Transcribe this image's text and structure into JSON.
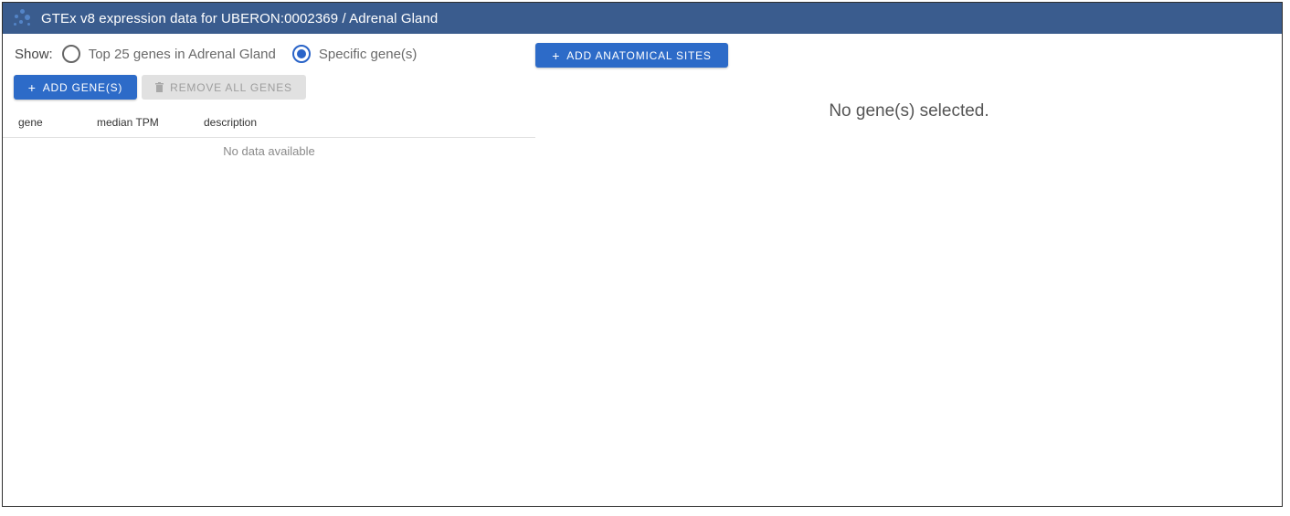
{
  "header": {
    "title": "GTEx v8 expression data for UBERON:0002369 / Adrenal Gland",
    "logo_icon": "gtex-logo-icon",
    "color": "#3a5c8e"
  },
  "controls": {
    "show_label": "Show:",
    "options": [
      {
        "label": "Top 25 genes in Adrenal Gland",
        "selected": false
      },
      {
        "label": "Specific gene(s)",
        "selected": true
      }
    ],
    "add_genes_label": "ADD GENE(S)",
    "add_genes_icon": "plus-icon",
    "remove_all_label": "REMOVE ALL GENES",
    "remove_all_icon": "trash-icon",
    "add_sites_label": "ADD ANATOMICAL SITES",
    "add_sites_icon": "plus-icon",
    "accent": "#2d6bc8"
  },
  "table": {
    "columns": [
      "gene",
      "median TPM",
      "description"
    ],
    "empty_text": "No data available"
  },
  "chart_panel": {
    "message": "No gene(s) selected."
  }
}
